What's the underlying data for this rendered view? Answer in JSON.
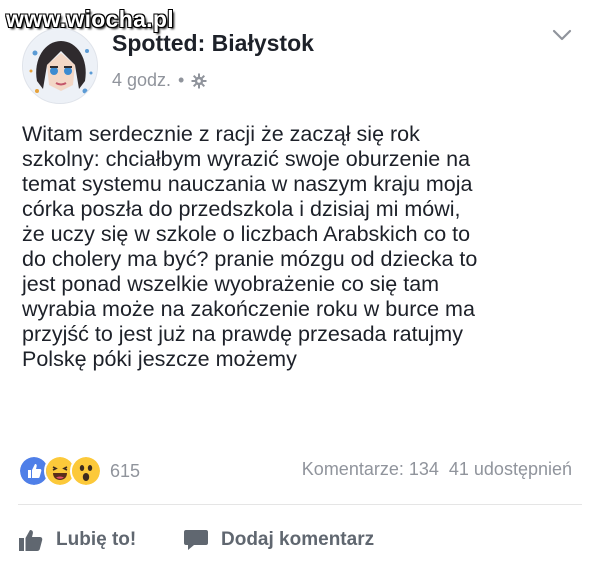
{
  "watermark": "www.wiocha.pl",
  "post": {
    "page_name": "Spotted: Białystok",
    "time": "4 godz.",
    "separator": "•",
    "text": "Witam serdecznie z racji że zaczął się rok\nszkolny: chciałbym wyrazić swoje oburzenie na\ntemat systemu nauczania w naszym kraju moja\ncórka poszła do przedszkola i dzisiaj mi mówi,\nże uczy się w szkole o liczbach Arabskich co to\ndo cholery ma być? pranie mózgu od dziecka to\njest ponad wszelkie wyobrażenie co się tam\nwyrabia może na zakończenie roku w burce ma\nprzyjść to jest już na prawdę przesada ratujmy\nPolskę póki jeszcze możemy"
  },
  "reactions": {
    "icons": [
      "like-icon",
      "haha-icon",
      "wow-icon"
    ],
    "count": "615"
  },
  "stats": {
    "comments": "Komentarze: 134",
    "shares": "41 udostępnień"
  },
  "actions": {
    "like_label": "Lubię to!",
    "comment_label": "Dodaj komentarz"
  },
  "colors": {
    "like_blue": "#4f7fe8",
    "reaction_yellow": "#fcc93a",
    "muted_text": "#90949c"
  }
}
